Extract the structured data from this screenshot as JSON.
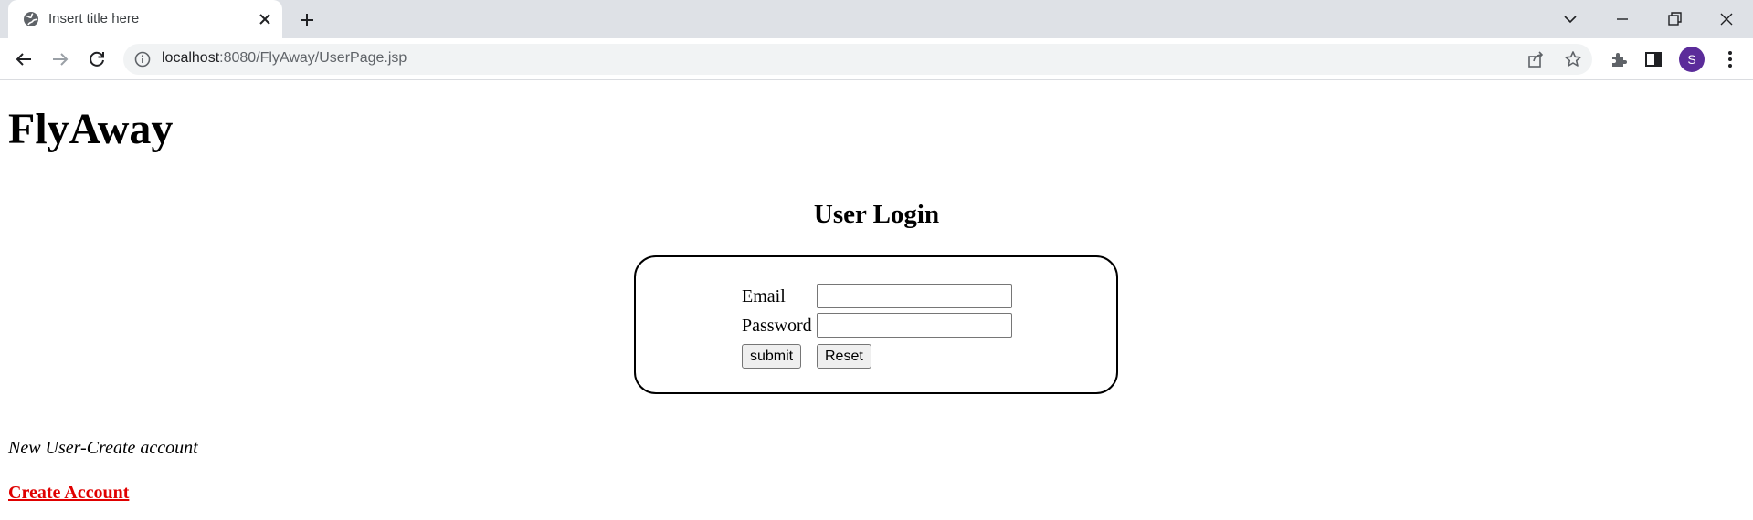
{
  "browser": {
    "tab_title": "Insert title here",
    "url_host": "localhost",
    "url_rest": ":8080/FlyAway/UserPage.jsp",
    "profile_initial": "S",
    "profile_color": "#5b2c9a",
    "icons": [
      "globe-icon",
      "close-icon",
      "plus-icon",
      "chevron-down-icon",
      "minimize-icon",
      "restore-icon",
      "close-window-icon",
      "back-arrow-icon",
      "forward-arrow-icon",
      "reload-icon",
      "info-icon",
      "share-icon",
      "star-icon",
      "puzzle-icon",
      "side-panel-icon",
      "kebab-menu-icon"
    ]
  },
  "page": {
    "site_title": "FlyAway",
    "login_heading": "User Login",
    "form": {
      "email_label": "Email",
      "email_value": "",
      "password_label": "Password",
      "password_value": "",
      "submit_label": "submit",
      "reset_label": "Reset"
    },
    "new_user_text": "New User-Create account",
    "create_account_link": "Create Account",
    "link_color": "#e00000"
  }
}
